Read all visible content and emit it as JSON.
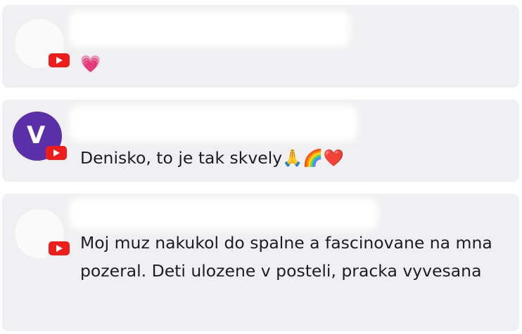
{
  "comments": [
    {
      "text": "💗",
      "avatar_letter": ""
    },
    {
      "text": "Denisko, to je tak skvely🙏🌈❤️",
      "avatar_letter": "V"
    },
    {
      "text": "Moj muz nakukol do spalne a fascinovane na mna pozeral. Deti ulozene v posteli, pracka vyvesana",
      "avatar_letter": ""
    }
  ],
  "colors": {
    "card_bg": "#f0f0f2",
    "badge_red": "#ef1c1c",
    "avatar_purple": "#5a2fa8",
    "text": "#1d1d1f"
  },
  "icons": [
    "youtube-badge-icon"
  ]
}
